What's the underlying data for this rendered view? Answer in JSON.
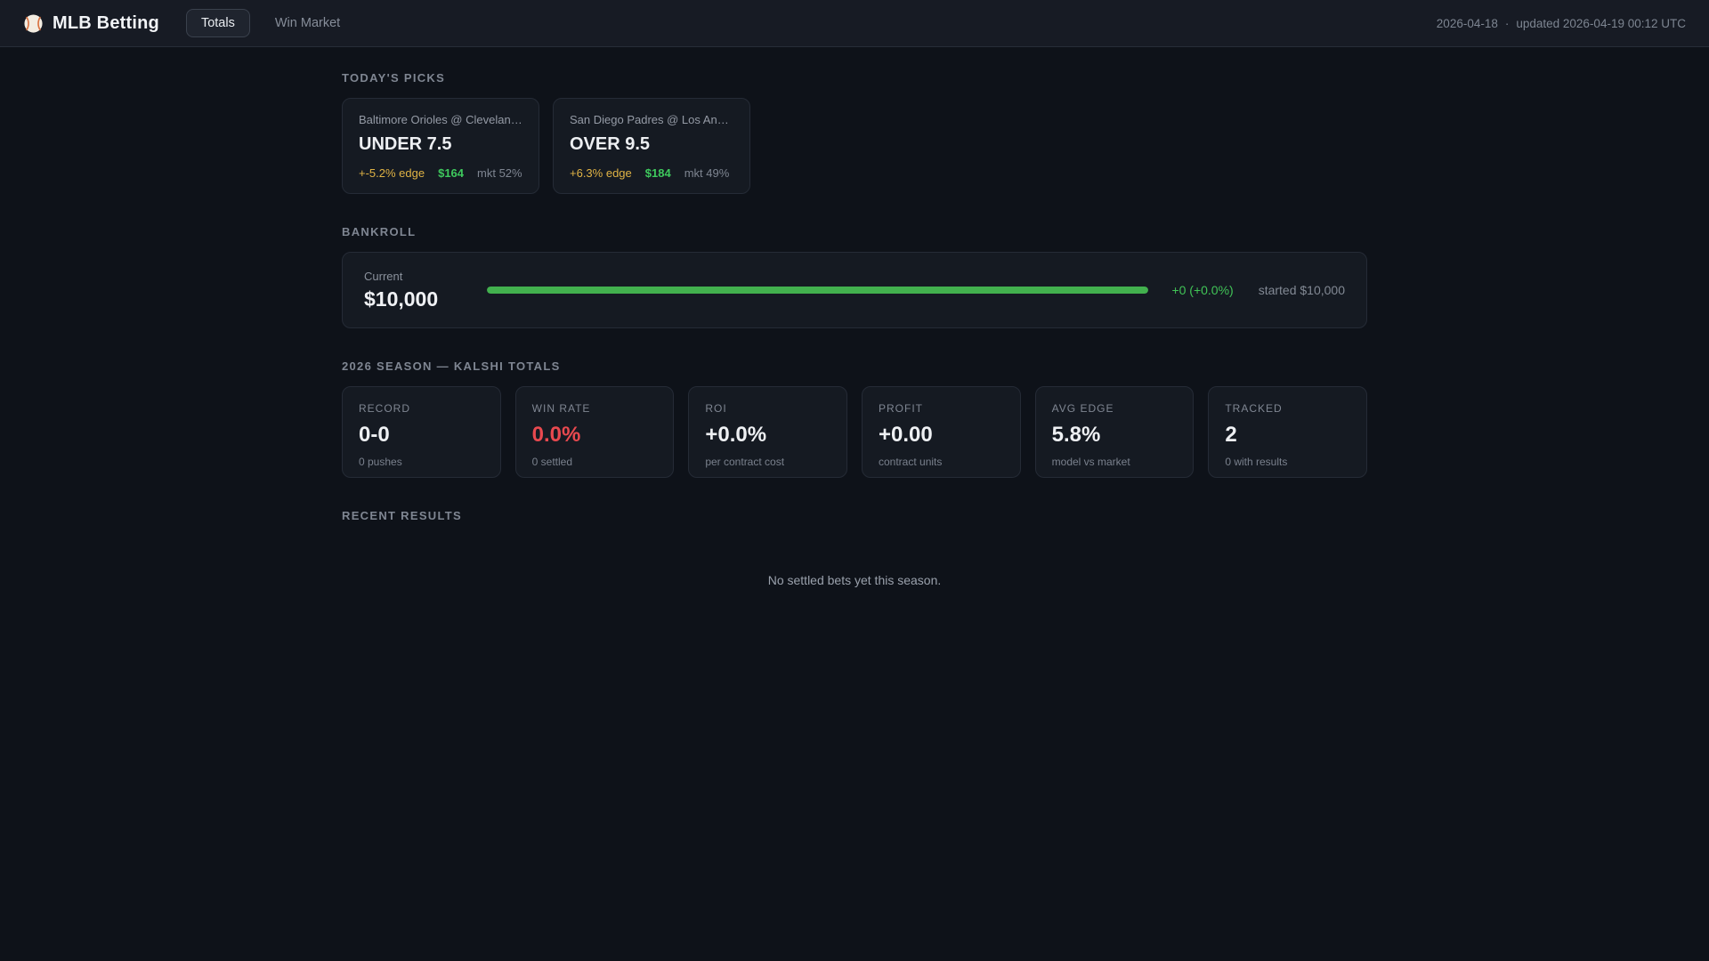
{
  "header": {
    "logo_icon": "baseball-icon",
    "title": "MLB Betting",
    "tabs": [
      {
        "label": "Totals",
        "active": true
      },
      {
        "label": "Win Market",
        "active": false
      }
    ],
    "game_date": "2026-04-18",
    "separator": "·",
    "updated": "updated 2026-04-19 00:12 UTC"
  },
  "picks": {
    "title": "TODAY'S PICKS",
    "cards": [
      {
        "matchup": "Baltimore Orioles @ Cleveland Gu…",
        "selection": "UNDER 7.5",
        "edge": "+-5.2% edge",
        "price": "$164",
        "market": "mkt 52%"
      },
      {
        "matchup": "San Diego Padres @ Los Angeles…",
        "selection": "OVER 9.5",
        "edge": "+6.3% edge",
        "price": "$184",
        "market": "mkt 49%"
      }
    ]
  },
  "bankroll": {
    "title": "BANKROLL",
    "current_label": "Current",
    "current_value": "$10,000",
    "progress_pct": 100,
    "change": "+0 (+0.0%)",
    "started": "started $10,000"
  },
  "season": {
    "title": "2026 SEASON — KALSHI TOTALS",
    "stats": [
      {
        "label": "RECORD",
        "value": "0-0",
        "sub": "0 pushes",
        "tone": "neutral"
      },
      {
        "label": "WIN RATE",
        "value": "0.0%",
        "sub": "0 settled",
        "tone": "negative"
      },
      {
        "label": "ROI",
        "value": "+0.0%",
        "sub": "per contract cost",
        "tone": "neutral"
      },
      {
        "label": "PROFIT",
        "value": "+0.00",
        "sub": "contract units",
        "tone": "neutral"
      },
      {
        "label": "AVG EDGE",
        "value": "5.8%",
        "sub": "model vs market",
        "tone": "neutral"
      },
      {
        "label": "TRACKED",
        "value": "2",
        "sub": "0 with results",
        "tone": "neutral"
      }
    ]
  },
  "recent": {
    "title": "RECENT RESULTS",
    "empty_message": "No settled bets yet this season."
  },
  "colors": {
    "background": "#0e1219",
    "topbar": "#171b24",
    "card": "#151a22",
    "card_border": "#252b36",
    "green": "#42b14e",
    "green_text": "#41c457",
    "amber": "#e0b345",
    "red": "#e8494f"
  }
}
